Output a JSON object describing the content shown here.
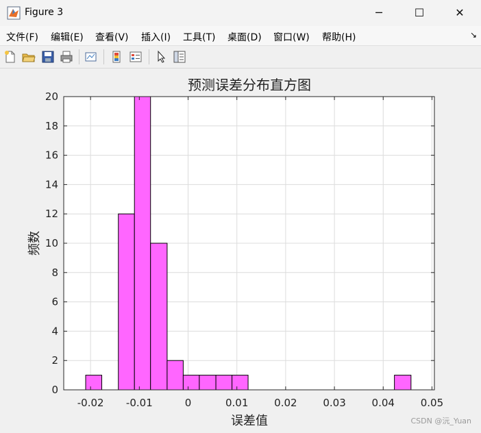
{
  "window": {
    "title": "Figure 3",
    "controls": {
      "minimize": "─",
      "maximize": "☐",
      "close": "✕"
    }
  },
  "menu": {
    "items": [
      "文件(F)",
      "编辑(E)",
      "查看(V)",
      "插入(I)",
      "工具(T)",
      "桌面(D)",
      "窗口(W)",
      "帮助(H)"
    ],
    "overflow_glyph": "↘"
  },
  "toolbar": {
    "icons": [
      "new-figure-icon",
      "open-file-icon",
      "save-icon",
      "print-icon",
      "link-plot-icon",
      "colorbar-icon",
      "legend-icon",
      "pointer-icon",
      "property-editor-icon"
    ]
  },
  "chart_data": {
    "type": "bar",
    "title": "预测误差分布直方图",
    "xlabel": "误差值",
    "ylabel": "频数",
    "bin_edges": [
      -0.021,
      -0.0177,
      -0.0143,
      -0.011,
      -0.0077,
      -0.0043,
      -0.001,
      0.0023,
      0.0057,
      0.009,
      0.0123,
      0.0157,
      0.019,
      0.0223,
      0.0257,
      0.029,
      0.0323,
      0.0357,
      0.039,
      0.0423,
      0.0457,
      0.049
    ],
    "counts": [
      1,
      0,
      12,
      20,
      10,
      2,
      1,
      1,
      1,
      1,
      0,
      0,
      0,
      0,
      0,
      0,
      0,
      0,
      0,
      1,
      0
    ],
    "xlim": [
      -0.0255,
      0.0505
    ],
    "ylim": [
      0,
      20
    ],
    "xticks": [
      -0.02,
      -0.01,
      0,
      0.01,
      0.02,
      0.03,
      0.04,
      0.05
    ],
    "xtick_labels": [
      "-0.02",
      "-0.01",
      "0",
      "0.01",
      "0.02",
      "0.03",
      "0.04",
      "0.05"
    ],
    "yticks": [
      0,
      2,
      4,
      6,
      8,
      10,
      12,
      14,
      16,
      18,
      20
    ],
    "ytick_labels": [
      "0",
      "2",
      "4",
      "6",
      "8",
      "10",
      "12",
      "14",
      "16",
      "18",
      "20"
    ],
    "grid": true,
    "bar_color": "#ff66ff",
    "edge_color": "#000000"
  },
  "watermark": "CSDN @沅_Yuan"
}
